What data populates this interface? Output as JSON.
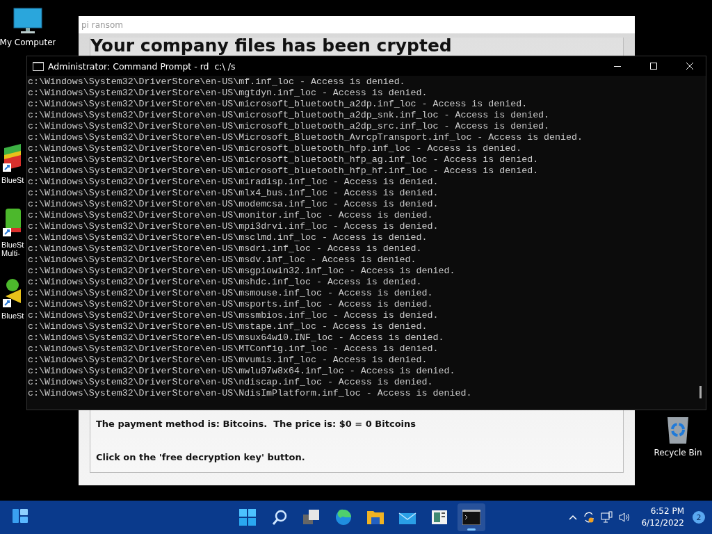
{
  "desktop_icons": [
    {
      "label": "My Computer",
      "kind": "computer"
    },
    {
      "label": "BlueSt",
      "kind": "stack"
    },
    {
      "label": "BlueSt\nMulti-",
      "kind": "multi"
    },
    {
      "label": "BlueSt",
      "kind": "x"
    },
    {
      "label": "Recycle Bin",
      "kind": "bin"
    }
  ],
  "ransom_window": {
    "title": "pi ransom",
    "heading": "Your company files has been crypted",
    "payment": "The payment method is: Bitcoins.  The price is: $0 = 0 Bitcoins",
    "instruction": "Click on the 'free decryption key' button."
  },
  "console_window": {
    "title": "Administrator: Command Prompt - rd  c:\\ /s",
    "lines": [
      "c:\\Windows\\System32\\DriverStore\\en-US\\mf.inf_loc - Access is denied.",
      "c:\\Windows\\System32\\DriverStore\\en-US\\mgtdyn.inf_loc - Access is denied.",
      "c:\\Windows\\System32\\DriverStore\\en-US\\microsoft_bluetooth_a2dp.inf_loc - Access is denied.",
      "c:\\Windows\\System32\\DriverStore\\en-US\\microsoft_bluetooth_a2dp_snk.inf_loc - Access is denied.",
      "c:\\Windows\\System32\\DriverStore\\en-US\\microsoft_bluetooth_a2dp_src.inf_loc - Access is denied.",
      "c:\\Windows\\System32\\DriverStore\\en-US\\Microsoft_Bluetooth_AvrcpTransport.inf_loc - Access is denied.",
      "c:\\Windows\\System32\\DriverStore\\en-US\\microsoft_bluetooth_hfp.inf_loc - Access is denied.",
      "c:\\Windows\\System32\\DriverStore\\en-US\\microsoft_bluetooth_hfp_ag.inf_loc - Access is denied.",
      "c:\\Windows\\System32\\DriverStore\\en-US\\microsoft_bluetooth_hfp_hf.inf_loc - Access is denied.",
      "c:\\Windows\\System32\\DriverStore\\en-US\\miradisp.inf_loc - Access is denied.",
      "c:\\Windows\\System32\\DriverStore\\en-US\\mlx4_bus.inf_loc - Access is denied.",
      "c:\\Windows\\System32\\DriverStore\\en-US\\modemcsa.inf_loc - Access is denied.",
      "c:\\Windows\\System32\\DriverStore\\en-US\\monitor.inf_loc - Access is denied.",
      "c:\\Windows\\System32\\DriverStore\\en-US\\mpi3drvi.inf_loc - Access is denied.",
      "c:\\Windows\\System32\\DriverStore\\en-US\\msclmd.inf_loc - Access is denied.",
      "c:\\Windows\\System32\\DriverStore\\en-US\\msdri.inf_loc - Access is denied.",
      "c:\\Windows\\System32\\DriverStore\\en-US\\msdv.inf_loc - Access is denied.",
      "c:\\Windows\\System32\\DriverStore\\en-US\\msgpiowin32.inf_loc - Access is denied.",
      "c:\\Windows\\System32\\DriverStore\\en-US\\mshdc.inf_loc - Access is denied.",
      "c:\\Windows\\System32\\DriverStore\\en-US\\msmouse.inf_loc - Access is denied.",
      "c:\\Windows\\System32\\DriverStore\\en-US\\msports.inf_loc - Access is denied.",
      "c:\\Windows\\System32\\DriverStore\\en-US\\mssmbios.inf_loc - Access is denied.",
      "c:\\Windows\\System32\\DriverStore\\en-US\\mstape.inf_loc - Access is denied.",
      "c:\\Windows\\System32\\DriverStore\\en-US\\msux64w10.INF_loc - Access is denied.",
      "c:\\Windows\\System32\\DriverStore\\en-US\\MTConfig.inf_loc - Access is denied.",
      "c:\\Windows\\System32\\DriverStore\\en-US\\mvumis.inf_loc - Access is denied.",
      "c:\\Windows\\System32\\DriverStore\\en-US\\mwlu97w8x64.inf_loc - Access is denied.",
      "c:\\Windows\\System32\\DriverStore\\en-US\\ndiscap.inf_loc - Access is denied.",
      "c:\\Windows\\System32\\DriverStore\\en-US\\NdisImPlatform.inf_loc - Access is denied."
    ]
  },
  "taskbar": {
    "apps": [
      {
        "kind": "start",
        "selected": false
      },
      {
        "kind": "search",
        "selected": false
      },
      {
        "kind": "taskview",
        "selected": false
      },
      {
        "kind": "browser",
        "selected": false
      },
      {
        "kind": "folder",
        "selected": false
      },
      {
        "kind": "mail",
        "selected": false
      },
      {
        "kind": "news",
        "selected": false
      },
      {
        "kind": "terminal",
        "selected": true
      }
    ],
    "time": "6:52 PM",
    "date": "6/12/2022",
    "notifications": "2"
  }
}
